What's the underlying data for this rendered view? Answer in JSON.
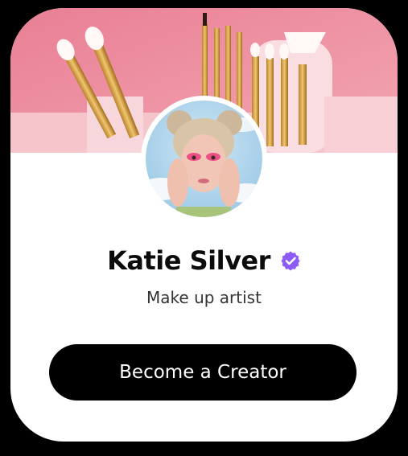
{
  "profile": {
    "name": "Katie Silver",
    "role": "Make up artist",
    "verified": true,
    "verified_badge_color": "#8b5cf6"
  },
  "cta": {
    "label": "Become a Creator"
  },
  "colors": {
    "card_bg": "#ffffff",
    "page_bg": "#000000",
    "cover_pink": "#e88a9a",
    "button_bg": "#000000",
    "button_text": "#ffffff"
  },
  "icons": {
    "verified": "verified-badge-icon"
  }
}
